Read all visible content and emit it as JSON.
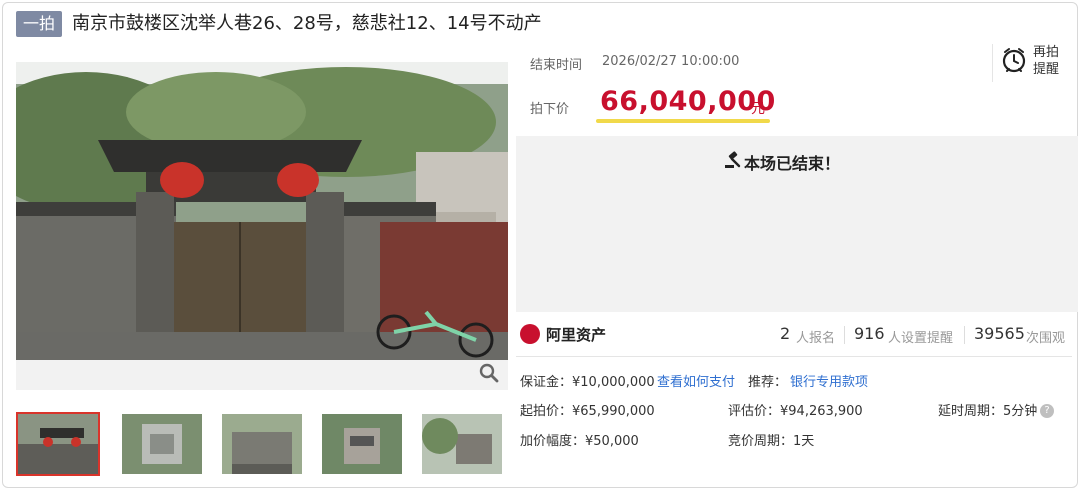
{
  "header": {
    "badge": "一拍",
    "title": "南京市鼓楼区沈举人巷26、28号，慈悲社12、14号不动产"
  },
  "auction": {
    "end_label": "结束时间",
    "end_time": "2026/02/27 10:00:00",
    "price_label": "拍下价",
    "price": "66,040,000",
    "price_unit": "元",
    "remind_label": "再拍\n提醒",
    "status": "本场已结束！"
  },
  "brand": {
    "name": "阿里资产"
  },
  "stats": [
    {
      "num": "2",
      "label": "人报名"
    },
    {
      "num": "916",
      "label": "人设置提醒"
    },
    {
      "num": "39565",
      "label": "次围观"
    }
  ],
  "details": {
    "deposit": "保证金：¥10,000,000",
    "pay_link": "查看如何支付",
    "recommend_label": "推荐：",
    "recommend_link": "银行专用款项",
    "start_price": "起拍价：¥65,990,000",
    "assess_price": "评估价：¥94,263,900",
    "delay": "延时周期：5分钟",
    "increment": "加价幅度：¥50,000",
    "bid_period": "竞价周期：1天"
  },
  "colors": {
    "accent": "#c8102e",
    "badge": "#7f8aa3",
    "link": "#2f6fd0",
    "highlight": "#f1d94a"
  },
  "icons": [
    "zoom-icon",
    "alarm-clock-icon",
    "gavel-icon",
    "help-icon"
  ]
}
